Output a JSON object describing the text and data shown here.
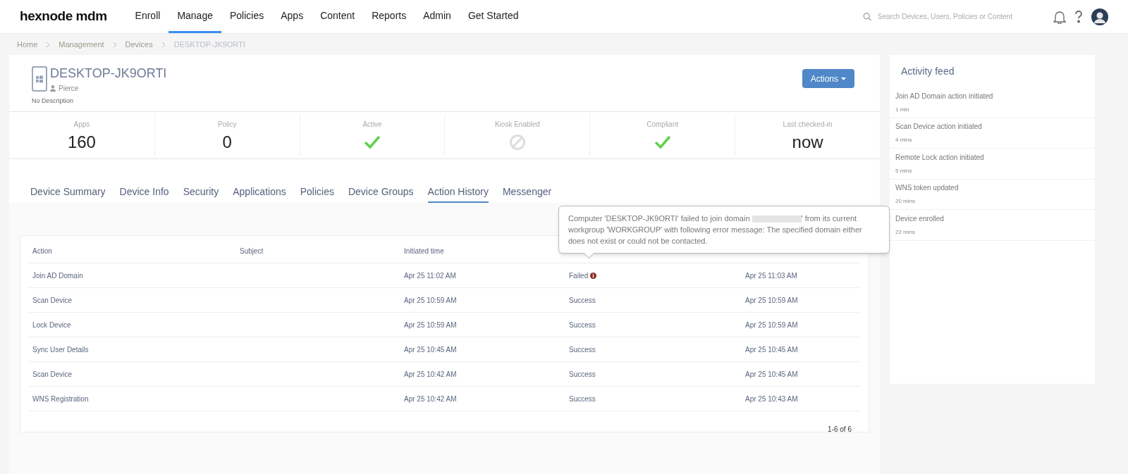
{
  "header": {
    "logo": "hexnode mdm",
    "nav": [
      {
        "label": "Enroll",
        "selected": false
      },
      {
        "label": "Manage",
        "selected": true
      },
      {
        "label": "Policies",
        "selected": false
      },
      {
        "label": "Apps",
        "selected": false
      },
      {
        "label": "Content",
        "selected": false
      },
      {
        "label": "Reports",
        "selected": false
      },
      {
        "label": "Admin",
        "selected": false
      },
      {
        "label": "Get Started",
        "selected": false
      }
    ],
    "search": {
      "placeholder": "Search Devices, Users, Policies or Content"
    }
  },
  "breadcrumb": [
    "Home",
    "Management",
    "Devices",
    "DESKTOP-JK9ORTI"
  ],
  "device": {
    "name": "DESKTOP-JK9ORTI",
    "user": "Pierce",
    "description": "No Description",
    "actions_button": "Actions"
  },
  "stats": [
    {
      "label": "Apps",
      "kind": "number",
      "value": "160"
    },
    {
      "label": "Policy",
      "kind": "number",
      "value": "0"
    },
    {
      "label": "Active",
      "kind": "check"
    },
    {
      "label": "Kiosk Enabled",
      "kind": "blocked"
    },
    {
      "label": "Compliant",
      "kind": "check"
    },
    {
      "label": "Last checked-in",
      "kind": "number",
      "value": "now"
    }
  ],
  "tabs": [
    {
      "label": "Device Summary",
      "selected": false
    },
    {
      "label": "Device Info",
      "selected": false
    },
    {
      "label": "Security",
      "selected": false
    },
    {
      "label": "Applications",
      "selected": false
    },
    {
      "label": "Policies",
      "selected": false
    },
    {
      "label": "Device Groups",
      "selected": false
    },
    {
      "label": "Action History",
      "selected": true
    },
    {
      "label": "Messenger",
      "selected": false
    }
  ],
  "table": {
    "columns": [
      "Action",
      "Subject",
      "Initiated time"
    ],
    "rows": [
      {
        "action": "Join AD Domain",
        "initiated": "Apr 25 11:02 AM",
        "status": "Failed",
        "error": true,
        "completed": "Apr 25 11:03 AM"
      },
      {
        "action": "Scan Device",
        "initiated": "Apr 25 10:59 AM",
        "status": "Success",
        "error": false,
        "completed": "Apr 25 10:59 AM"
      },
      {
        "action": "Lock Device",
        "initiated": "Apr 25 10:59 AM",
        "status": "Success",
        "error": false,
        "completed": "Apr 25 10:59 AM"
      },
      {
        "action": "Sync User Details",
        "initiated": "Apr 25 10:45 AM",
        "status": "Success",
        "error": false,
        "completed": "Apr 25 10:45 AM"
      },
      {
        "action": "Scan Device",
        "initiated": "Apr 25 10:42 AM",
        "status": "Success",
        "error": false,
        "completed": "Apr 25 10:45 AM"
      },
      {
        "action": "WNS Registration",
        "initiated": "Apr 25 10:42 AM",
        "status": "Success",
        "error": false,
        "completed": "Apr 25 10:43 AM"
      }
    ],
    "pagination": "1-6 of 6"
  },
  "tooltip": {
    "before": "Computer 'DESKTOP-JK9ORTI' failed to join domain",
    "after": "' from its current workgroup 'WORKGROUP' with following error message: The specified domain either does not exist or could not be contacted."
  },
  "activity_feed": {
    "title": "Activity feed",
    "items": [
      {
        "text": "Join AD Domain action initiated",
        "time": "1 min"
      },
      {
        "text": "Scan Device action initiated",
        "time": "4 mins"
      },
      {
        "text": "Remote Lock action initiated",
        "time": "5 mins"
      },
      {
        "text": "WNS token updated",
        "time": "20 mins"
      },
      {
        "text": "Device enrolled",
        "time": "22 mins"
      }
    ]
  }
}
